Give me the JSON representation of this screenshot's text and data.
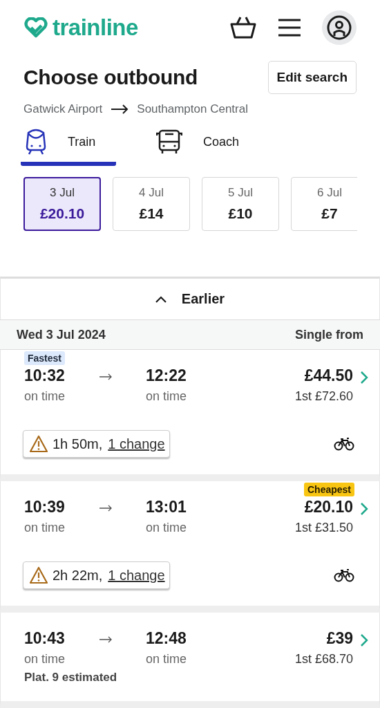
{
  "header": {
    "logo": "trainline"
  },
  "page": {
    "title": "Choose outbound",
    "edit_button": "Edit search",
    "origin": "Gatwick Airport",
    "destination": "Southampton Central"
  },
  "tabs": [
    {
      "label": "Train",
      "kind": "train",
      "selected": true
    },
    {
      "label": "Coach",
      "kind": "coach",
      "selected": false
    }
  ],
  "dates": [
    {
      "date": "3 Jul",
      "price": "£20.10",
      "selected": true
    },
    {
      "date": "4 Jul",
      "price": "£14",
      "selected": false
    },
    {
      "date": "5 Jul",
      "price": "£10",
      "selected": false
    },
    {
      "date": "6 Jul",
      "price": "£7",
      "selected": false
    }
  ],
  "earlier_button": "Earlier",
  "list_header": {
    "date": "Wed 3 Jul 2024",
    "price_label": "Single from"
  },
  "journeys": [
    {
      "badge": {
        "kind": "fastest",
        "text": "Fastest"
      },
      "depart": "10:32",
      "depart_status": "on time",
      "arrive": "12:22",
      "arrive_status": "on time",
      "price": "£44.50",
      "first_class": "1st £72.60",
      "duration": "1h 50m,",
      "changes": "1 change",
      "bike": true
    },
    {
      "badge": {
        "kind": "cheapest",
        "text": "Cheapest"
      },
      "depart": "10:39",
      "depart_status": "on time",
      "arrive": "13:01",
      "arrive_status": "on time",
      "price": "£20.10",
      "first_class": "1st £31.50",
      "duration": "2h 22m,",
      "changes": "1 change",
      "bike": true
    },
    {
      "depart": "10:43",
      "depart_status": "on time",
      "arrive": "12:48",
      "arrive_status": "on time",
      "price": "£39",
      "first_class": "1st £68.70",
      "platform": "Plat. 9 estimated"
    }
  ]
}
